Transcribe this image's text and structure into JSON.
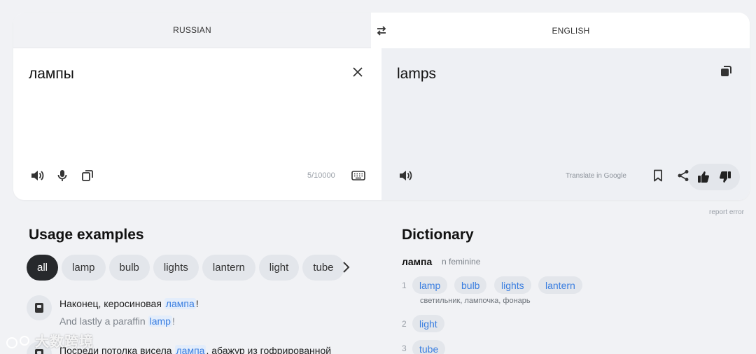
{
  "languages": {
    "source": "RUSSIAN",
    "target": "ENGLISH"
  },
  "source": {
    "text": "лампы",
    "counter": "5/10000"
  },
  "target": {
    "text": "lamps",
    "translate_in_google": "Translate in Google"
  },
  "report_error": "report error",
  "usage": {
    "heading": "Usage examples",
    "chips": [
      "all",
      "lamp",
      "bulb",
      "lights",
      "lantern",
      "light",
      "tube"
    ],
    "examples": [
      {
        "src_before": "Наконец, керосиновая ",
        "src_hl": "лампа",
        "src_after": "!",
        "tgt_before": "And lastly a paraffin ",
        "tgt_hl": "lamp",
        "tgt_after": "!"
      },
      {
        "src_before": "Посреди потолка висела ",
        "src_hl": "лампа",
        "src_after": ", абажур из гофрированной"
      }
    ]
  },
  "dictionary": {
    "heading": "Dictionary",
    "word": "лампа",
    "pos": "n  feminine",
    "senses": [
      {
        "num": "1",
        "translations": [
          "lamp",
          "bulb",
          "lights",
          "lantern"
        ],
        "synonyms": "светильник, лампочка, фонарь"
      },
      {
        "num": "2",
        "translations": [
          "light"
        ]
      },
      {
        "num": "3",
        "translations": [
          "tube"
        ]
      }
    ]
  },
  "watermark": "大数跨境",
  "colors": {
    "accent": "#3a7ee0",
    "background": "#f1f2f5",
    "chip": "#e3e6eb",
    "chip_active": "#27292c"
  },
  "icons": [
    "swap-icon",
    "close-icon",
    "copy-icon",
    "speaker-icon",
    "microphone-icon",
    "tiles-icon",
    "keyboard-icon",
    "bookmark-icon",
    "share-icon",
    "thumbs-up-icon",
    "thumbs-down-icon",
    "chevron-right-icon",
    "book-icon"
  ]
}
